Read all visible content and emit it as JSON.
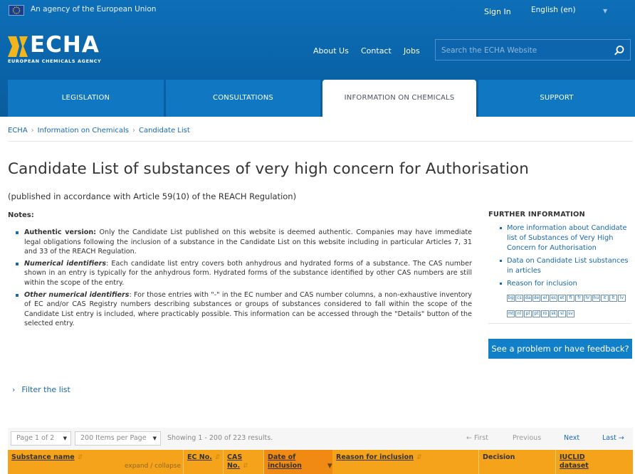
{
  "topbar": {
    "agency_text": "An agency of the European Union",
    "sign_in": "Sign In",
    "language": "English (en)"
  },
  "logo": {
    "name": "ECHA",
    "subtitle": "EUROPEAN CHEMICALS AGENCY"
  },
  "topnav": {
    "about": "About Us",
    "contact": "Contact",
    "jobs": "Jobs"
  },
  "search": {
    "placeholder": "Search the ECHA Website"
  },
  "mainnav": [
    "LEGISLATION",
    "CONSULTATIONS",
    "INFORMATION ON CHEMICALS",
    "SUPPORT"
  ],
  "breadcrumb": [
    "ECHA",
    "Information on Chemicals",
    "Candidate List"
  ],
  "page": {
    "title": "Candidate List of substances of very high concern for Authorisation",
    "subtitle": "(published in accordance with Article 59(10) of the REACH Regulation)"
  },
  "notes": {
    "heading": "Notes:",
    "items": [
      {
        "label": "Authentic version:",
        "text": " Only the Candidate List published on this website is deemed authentic. Companies may have immediate legal obligations following the inclusion of a substance in the Candidate List on this website including in particular Articles 7, 31 and 33 of the REACH Regulation."
      },
      {
        "label": "Numerical identifiers",
        "text": ": Each candidate list entry covers both anhydrous and hydrated forms of a substance. The CAS number shown in an entry is typically for the anhydrous form. Hydrated forms of the substance identified by other CAS numbers are still within the scope of the entry."
      },
      {
        "label": "Other numerical identifiers",
        "text": ": For those entries with \"-\" in the EC number and CAS number columns, a non-exhaustive inventory of EC and/or CAS Registry numbers describing substances or groups of substances considered to fall within the scope of the Candidate List entry is included, where practicably possible. This information can be accessed through the \"Details\" button of the selected entry."
      }
    ]
  },
  "further": {
    "title": "FURTHER INFORMATION",
    "links": [
      "More information about Candidate list of Substances of Very High Concern for Authorisation",
      "Data on Candidate List substances in articles",
      "Reason for inclusion"
    ],
    "languages": [
      "bg",
      "cs",
      "da",
      "de",
      "el",
      "es",
      "et",
      "fi",
      "fr",
      "hr",
      "hu",
      "it",
      "lt",
      "lv",
      "mt",
      "nl",
      "pl",
      "pt",
      "ro",
      "sk",
      "sl",
      "sv"
    ],
    "feedback": "See a problem or have feedback?"
  },
  "filter": {
    "label": "Filter the list"
  },
  "pager": {
    "page": "Page 1 of 2",
    "per_page": "200 Items per Page",
    "showing": "Showing 1 - 200 of 223 results.",
    "first": "← First",
    "previous": "Previous",
    "next": "Next",
    "last": "Last →"
  },
  "table": {
    "columns": {
      "substance": "Substance name",
      "ec": "EC No.",
      "cas_1": "CAS",
      "cas_2": "No.",
      "date_1": "Date of",
      "date_2": "inclusion",
      "reason": "Reason for inclusion",
      "decision": "Decision",
      "iuclid_1": "IUCLID",
      "iuclid_2": "dataset"
    },
    "expand": "expand",
    "collapse": "collapse"
  },
  "colors": {
    "header_blue": "#0a63a8",
    "tab_blue": "#1077c3",
    "link_blue": "#1768b0",
    "table_orange": "#f5a31a",
    "logo_yellow": "#f2b51c"
  }
}
